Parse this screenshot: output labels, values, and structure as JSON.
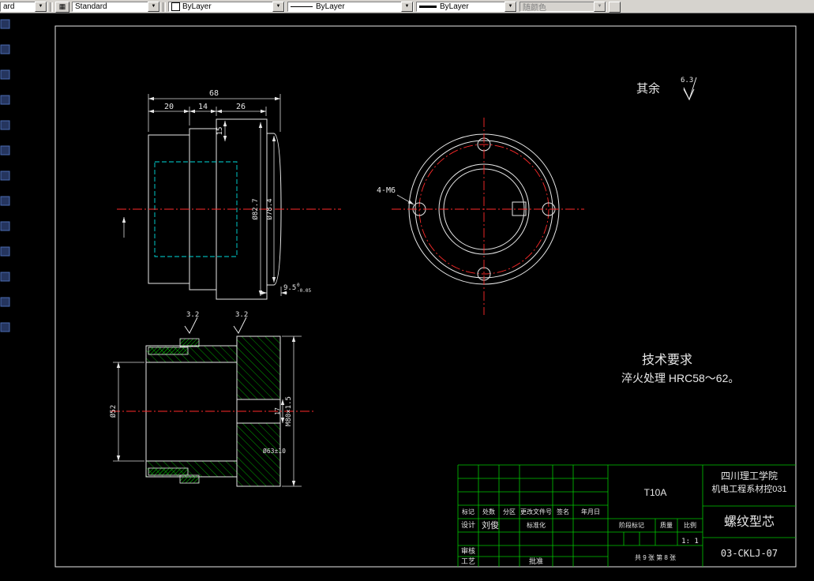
{
  "toolbar": {
    "partial_style": "ard",
    "text_style": "Standard",
    "color_value": "ByLayer",
    "linetype_value": "ByLayer",
    "lineweight_value": "ByLayer",
    "plotstyle_value": "随颜色"
  },
  "annotations": {
    "rest_label": "其余",
    "rest_roughness": "6.3",
    "tech_title": "技术要求",
    "tech_body": "淬火处理 HRC58～62。"
  },
  "side_view": {
    "dim_total": "68",
    "dim_a": "20",
    "dim_b": "14",
    "dim_c": "26",
    "dim_step": "15",
    "dim_od1": "Ø82.7",
    "dim_od2": "Ø78.4",
    "dim_depth": "9.5",
    "tol_up": "0",
    "tol_dn": "-0.05"
  },
  "front_view": {
    "hole_note": "4-M6"
  },
  "section_view": {
    "dim_bore": "Ø52",
    "dim_thread": "M80×1.5",
    "dim_h": "17",
    "dim_hole": "Ø63±10",
    "finish_a": "3.2",
    "finish_b": "3.2"
  },
  "title_block": {
    "material": "T10A",
    "org_line1": "四川理工学院",
    "org_line2": "机电工程系材控031",
    "part_name": "螺纹型芯",
    "drawing_no": "03-CKLJ-07",
    "scale_value": "1: 1",
    "header_cells": [
      "标记",
      "处数",
      "分区",
      "更改文件号",
      "签名",
      "年月日"
    ],
    "row_design_label": "设计",
    "row_design_name": "刘俊",
    "row_standard_label": "标准化",
    "row_check_label": "审核",
    "row_process_label": "工艺",
    "row_approve_label": "批准",
    "stage_label": "阶段标记",
    "weight_label": "质量",
    "scale_label": "比例",
    "sheet_info": "共 9 张 第 8 张"
  }
}
